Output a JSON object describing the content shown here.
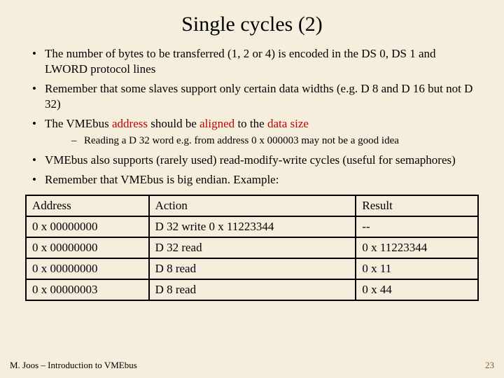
{
  "title": "Single cycles (2)",
  "bullets": {
    "b1": "The number of bytes to be transferred (1, 2 or 4) is encoded in the DS 0, DS 1 and LWORD protocol lines",
    "b2": "Remember that some slaves support only certain data widths (e.g. D 8 and D 16 but not D 32)",
    "b3_pre": "The VMEbus ",
    "b3_addr": "address",
    "b3_mid": " should be ",
    "b3_align": "aligned",
    "b3_mid2": " to the ",
    "b3_size": "data size",
    "b3_sub1": "Reading a D 32 word e.g. from address 0 x 000003 may not be a good idea",
    "b4": "VMEbus also supports (rarely used) read-modify-write cycles (useful for semaphores)",
    "b5": "Remember that VMEbus is big endian. Example:"
  },
  "table": {
    "h1": "Address",
    "h2": "Action",
    "h3": "Result",
    "r1c1": "0 x 00000000",
    "r1c2": "D 32 write 0 x 11223344",
    "r1c3": "--",
    "r2c1": "0 x 00000000",
    "r2c2": "D 32 read",
    "r2c3": "0 x 11223344",
    "r3c1": "0 x 00000000",
    "r3c2": "D 8 read",
    "r3c3": "0 x 11",
    "r4c1": "0 x 00000003",
    "r4c2": "D 8 read",
    "r4c3": "0 x 44"
  },
  "footer": {
    "left": "M. Joos – Introduction to VMEbus",
    "right": "23"
  }
}
